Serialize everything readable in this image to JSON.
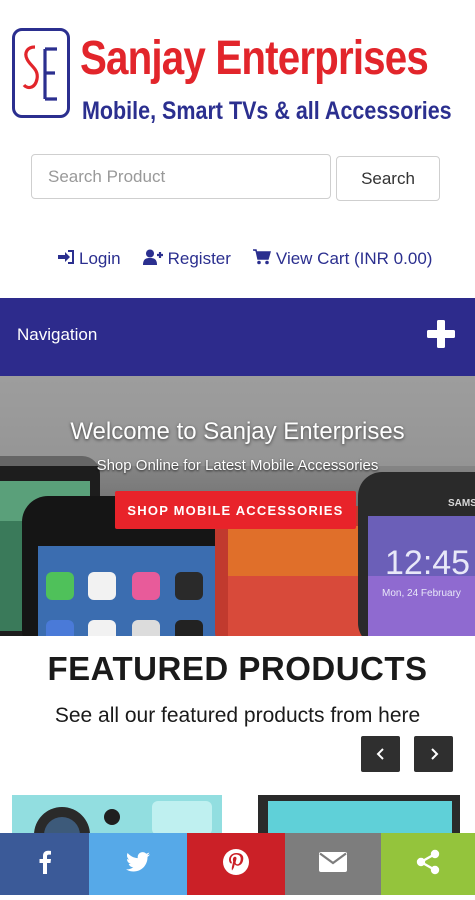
{
  "header": {
    "logo_letters": "SE",
    "brand_name": "Sanjay Enterprises",
    "tagline": "Mobile, Smart TVs & all Accessories",
    "brand_color": "#e2252b",
    "tagline_color": "#2b2f8f"
  },
  "search": {
    "placeholder": "Search Product",
    "value": "",
    "button_label": "Search"
  },
  "user_links": {
    "login": "Login",
    "register": "Register",
    "view_cart": "View Cart (INR 0.00)"
  },
  "navigation": {
    "label": "Navigation",
    "background": "#2d2b8c"
  },
  "hero": {
    "title": "Welcome to Sanjay Enterprises",
    "subtitle": "Shop Online for Latest Mobile Accessories",
    "cta_label": "SHOP MOBILE ACCESSORIES",
    "cta_color": "#e8232a",
    "phone_time": "12:45",
    "phone_date": "Mon, 24 February",
    "phone_brand": "SAMS"
  },
  "featured": {
    "title": "FEATURED PRODUCTS",
    "subtitle": "See all our featured products from here"
  },
  "share_bar": {
    "facebook_color": "#3b5a98",
    "twitter_color": "#56a9e8",
    "pinterest_color": "#cb2027",
    "email_color": "#7d7d7d",
    "share_color": "#94c43c",
    "icons": [
      "facebook-icon",
      "twitter-icon",
      "pinterest-icon",
      "email-icon",
      "share-icon"
    ]
  }
}
